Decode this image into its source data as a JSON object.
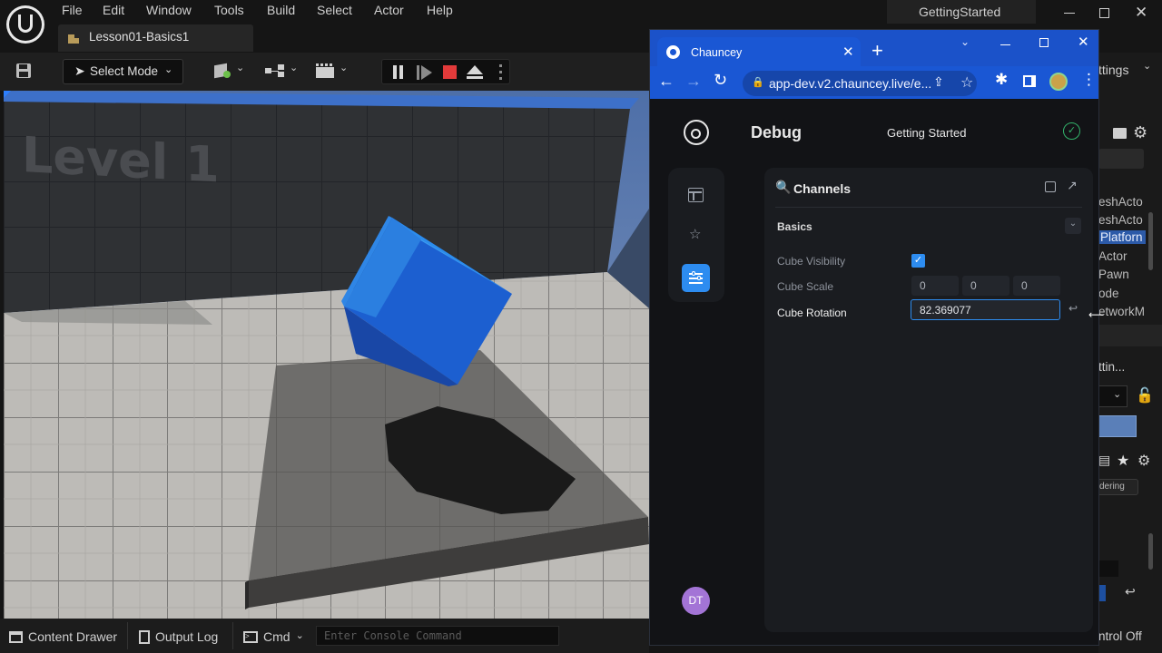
{
  "ue": {
    "menu": [
      "File",
      "Edit",
      "Window",
      "Tools",
      "Build",
      "Select",
      "Actor",
      "Help"
    ],
    "project_name": "GettingStarted",
    "level_tab": "Lesson01-Basics1",
    "select_mode": "Select Mode",
    "viewport_label": "Level 1",
    "bottom": {
      "content_drawer": "Content Drawer",
      "output_log": "Output Log",
      "cmd": "Cmd",
      "console_placeholder": "Enter Console Command"
    },
    "right_panel": {
      "settings_partial": "ttings",
      "outliner_items": [
        "eshActo",
        "eshActo",
        "Platforn",
        "Actor",
        "Pawn",
        "ode",
        "etworkM"
      ],
      "details_partial": "ttin...",
      "ordering_partial": "dering",
      "status_partial": "ntrol Off"
    }
  },
  "browser": {
    "tab_title": "Chauncey",
    "url": "app-dev.v2.chauncey.live/e...",
    "accent": "#1a57d4"
  },
  "app": {
    "section": "Debug",
    "project": "Getting Started",
    "search_label": "Channels",
    "group": "Basics",
    "fields": {
      "visibility_label": "Cube Visibility",
      "visibility_value": true,
      "scale_label": "Cube Scale",
      "scale_values": [
        "0",
        "0",
        "0"
      ],
      "rotation_label": "Cube Rotation",
      "rotation_value": "82.369077"
    },
    "user_initials": "DT",
    "accent": "#2d8cf0",
    "avatar_color": "#a374d6"
  }
}
